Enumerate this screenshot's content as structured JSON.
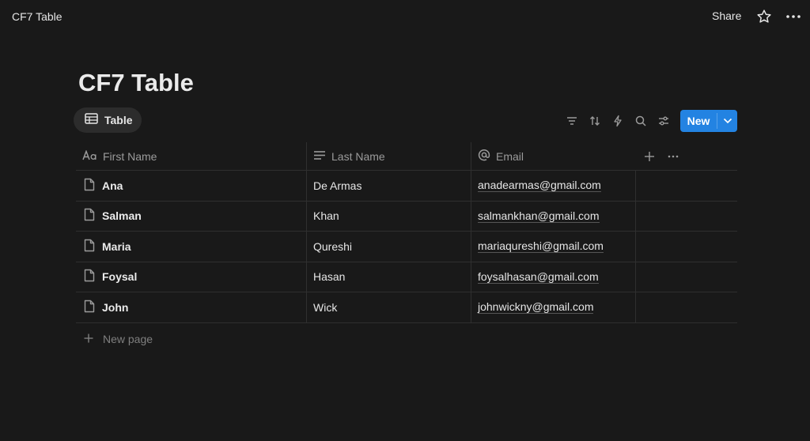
{
  "topbar": {
    "title": "CF7 Table",
    "share_label": "Share"
  },
  "page": {
    "title": "CF7 Table"
  },
  "view": {
    "tab_label": "Table"
  },
  "toolbar": {
    "icons": [
      "filter-icon",
      "sort-icon",
      "automation-icon",
      "search-icon",
      "settings-icon"
    ],
    "new_label": "New"
  },
  "table": {
    "columns": [
      {
        "label": "First Name",
        "icon": "title-icon"
      },
      {
        "label": "Last Name",
        "icon": "text-icon"
      },
      {
        "label": "Email",
        "icon": "at-icon"
      }
    ],
    "rows": [
      {
        "first": "Ana",
        "last": "De Armas",
        "email": "anadearmas@gmail.com"
      },
      {
        "first": "Salman",
        "last": "Khan",
        "email": "salmankhan@gmail.com"
      },
      {
        "first": "Maria",
        "last": "Qureshi",
        "email": "mariaqureshi@gmail.com"
      },
      {
        "first": "Foysal",
        "last": "Hasan",
        "email": "foysalhasan@gmail.com"
      },
      {
        "first": "John",
        "last": "Wick",
        "email": "johnwickny@gmail.com"
      }
    ],
    "new_page_label": "New page"
  },
  "colors": {
    "background": "#191919",
    "accent": "#2383e2"
  }
}
